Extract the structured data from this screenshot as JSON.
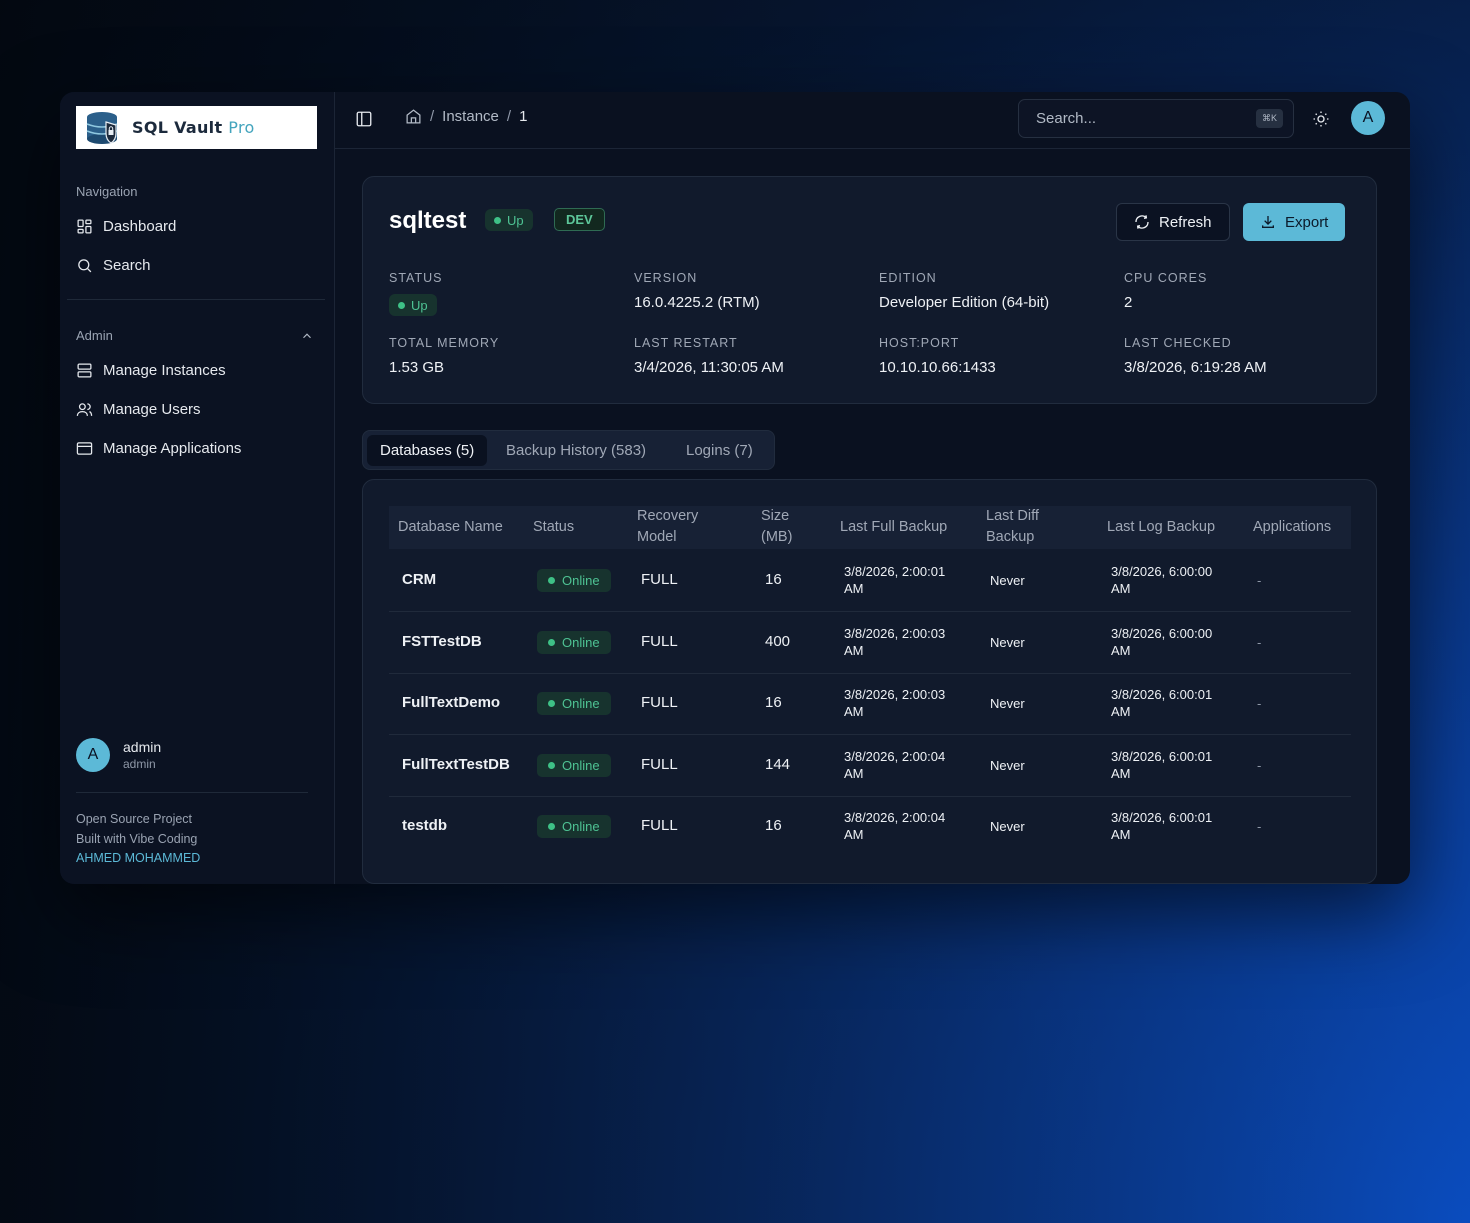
{
  "app": {
    "logo_text": "SQL Vault",
    "logo_pro": "Pro"
  },
  "sidebar": {
    "nav_heading": "Navigation",
    "nav_items": [
      {
        "label": "Dashboard",
        "icon": "dashboard-icon"
      },
      {
        "label": "Search",
        "icon": "search-icon"
      }
    ],
    "admin_heading": "Admin",
    "admin_items": [
      {
        "label": "Manage Instances",
        "icon": "server-icon"
      },
      {
        "label": "Manage Users",
        "icon": "users-icon"
      },
      {
        "label": "Manage Applications",
        "icon": "app-window-icon"
      }
    ],
    "user": {
      "initial": "A",
      "name": "admin",
      "role": "admin"
    },
    "footer": {
      "line1": "Open Source Project",
      "line2": "Built with Vibe Coding",
      "author": "AHMED MOHAMMED"
    }
  },
  "topbar": {
    "breadcrumb": {
      "section": "Instance",
      "current": "1",
      "sep": "/"
    },
    "search": {
      "placeholder": "Search...",
      "shortcut": "⌘K"
    },
    "avatar_initial": "A"
  },
  "instance": {
    "name": "sqltest",
    "status_badge": "Up",
    "env_badge": "DEV",
    "refresh_label": "Refresh",
    "export_label": "Export",
    "fields": {
      "status_label": "STATUS",
      "status_value": "Up",
      "version_label": "VERSION",
      "version_value": "16.0.4225.2 (RTM)",
      "edition_label": "EDITION",
      "edition_value": "Developer Edition (64-bit)",
      "cpu_label": "CPU CORES",
      "cpu_value": "2",
      "memory_label": "TOTAL MEMORY",
      "memory_value": "1.53 GB",
      "restart_label": "LAST RESTART",
      "restart_value": "3/4/2026, 11:30:05 AM",
      "host_label": "HOST:PORT",
      "host_value": "10.10.10.66:1433",
      "checked_label": "LAST CHECKED",
      "checked_value": "3/8/2026, 6:19:28 AM"
    }
  },
  "tabs": [
    "Databases (5)",
    "Backup History (583)",
    "Logins (7)"
  ],
  "table": {
    "headers": {
      "name": "Database Name",
      "status": "Status",
      "recovery_1": "Recovery",
      "recovery_2": "Model",
      "size_1": "Size",
      "size_2": "(MB)",
      "full": "Last Full Backup",
      "diff_1": "Last Diff",
      "diff_2": "Backup",
      "log": "Last Log Backup",
      "apps": "Applications"
    },
    "rows": [
      {
        "name": "CRM",
        "status": "Online",
        "recovery": "FULL",
        "size": "16",
        "full_1": "3/8/2026, 2:00:01",
        "full_2": "AM",
        "diff": "Never",
        "log_1": "3/8/2026, 6:00:00",
        "log_2": "AM",
        "apps": "-"
      },
      {
        "name": "FSTTestDB",
        "status": "Online",
        "recovery": "FULL",
        "size": "400",
        "full_1": "3/8/2026, 2:00:03",
        "full_2": "AM",
        "diff": "Never",
        "log_1": "3/8/2026, 6:00:00",
        "log_2": "AM",
        "apps": "-"
      },
      {
        "name": "FullTextDemo",
        "status": "Online",
        "recovery": "FULL",
        "size": "16",
        "full_1": "3/8/2026, 2:00:03",
        "full_2": "AM",
        "diff": "Never",
        "log_1": "3/8/2026, 6:00:01",
        "log_2": "AM",
        "apps": "-"
      },
      {
        "name": "FullTextTestDB",
        "status": "Online",
        "recovery": "FULL",
        "size": "144",
        "full_1": "3/8/2026, 2:00:04",
        "full_2": "AM",
        "diff": "Never",
        "log_1": "3/8/2026, 6:00:01",
        "log_2": "AM",
        "apps": "-"
      },
      {
        "name": "testdb",
        "status": "Online",
        "recovery": "FULL",
        "size": "16",
        "full_1": "3/8/2026, 2:00:04",
        "full_2": "AM",
        "diff": "Never",
        "log_1": "3/8/2026, 6:00:01",
        "log_2": "AM",
        "apps": "-"
      }
    ]
  },
  "colors": {
    "accent": "#5cb9d7",
    "status_green": "#3ec186",
    "panel": "#111a2c",
    "background": "#0a1120"
  }
}
